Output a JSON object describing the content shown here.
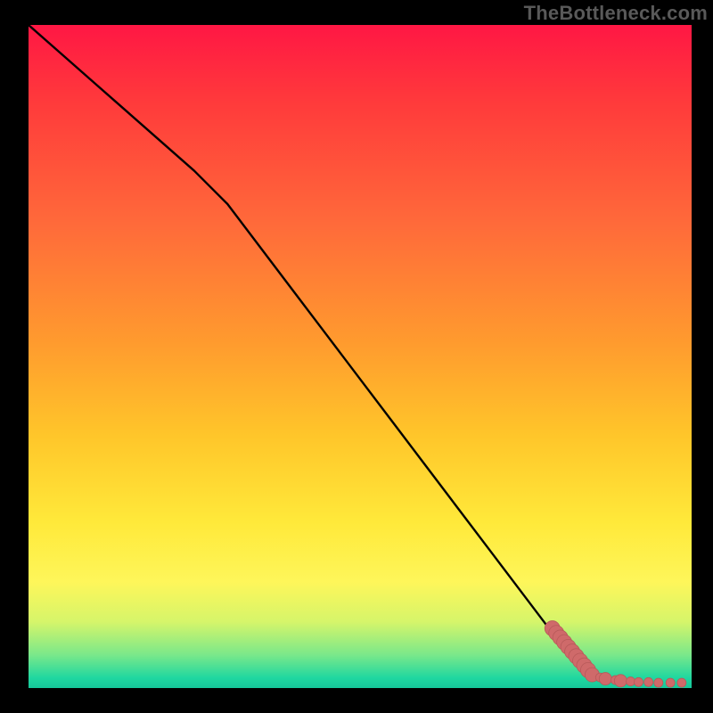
{
  "watermark": "TheBottleneck.com",
  "chart_data": {
    "type": "line",
    "title": "",
    "xlabel": "",
    "ylabel": "",
    "xlim": [
      0,
      100
    ],
    "ylim": [
      0,
      100
    ],
    "gradient_stops": [
      {
        "offset": 0.0,
        "color": "#ff1744"
      },
      {
        "offset": 0.12,
        "color": "#ff3b3b"
      },
      {
        "offset": 0.3,
        "color": "#ff6a3a"
      },
      {
        "offset": 0.48,
        "color": "#ff9b2e"
      },
      {
        "offset": 0.62,
        "color": "#ffc62a"
      },
      {
        "offset": 0.75,
        "color": "#ffe93a"
      },
      {
        "offset": 0.84,
        "color": "#fef65a"
      },
      {
        "offset": 0.9,
        "color": "#d6f56a"
      },
      {
        "offset": 0.95,
        "color": "#7ae88a"
      },
      {
        "offset": 0.985,
        "color": "#1fd7a0"
      },
      {
        "offset": 1.0,
        "color": "#16c79a"
      }
    ],
    "series": [
      {
        "name": "curve",
        "type": "line",
        "color": "#000000",
        "x": [
          0,
          5,
          10,
          15,
          20,
          25,
          30,
          35,
          40,
          45,
          50,
          55,
          60,
          65,
          70,
          75,
          80
        ],
        "y": [
          100,
          95.6,
          91.2,
          86.8,
          82.4,
          78.0,
          73.0,
          66.4,
          59.8,
          53.2,
          46.6,
          40.0,
          33.4,
          26.8,
          20.2,
          13.6,
          7.0
        ]
      },
      {
        "name": "points",
        "type": "scatter",
        "color": "#cf6a6a",
        "stroke": "#b85a5a",
        "x": [
          79.0,
          79.6,
          80.2,
          80.8,
          81.4,
          82.0,
          82.6,
          83.2,
          83.8,
          84.4,
          85.0,
          86.2,
          87.0,
          88.5,
          89.3,
          90.8,
          92.0,
          93.5,
          95.0,
          96.8,
          98.5
        ],
        "y": [
          9.0,
          8.3,
          7.6,
          6.9,
          6.2,
          5.5,
          4.8,
          4.1,
          3.4,
          2.7,
          2.0,
          1.6,
          1.4,
          1.2,
          1.1,
          1.0,
          0.9,
          0.9,
          0.8,
          0.8,
          0.8
        ],
        "r": [
          8.5,
          8.5,
          8.5,
          8.5,
          8.5,
          8.5,
          8.5,
          8.5,
          8.5,
          8.5,
          8.0,
          5.0,
          7.0,
          5.0,
          7.0,
          5.0,
          5.0,
          5.0,
          5.0,
          5.0,
          5.0
        ]
      }
    ]
  }
}
